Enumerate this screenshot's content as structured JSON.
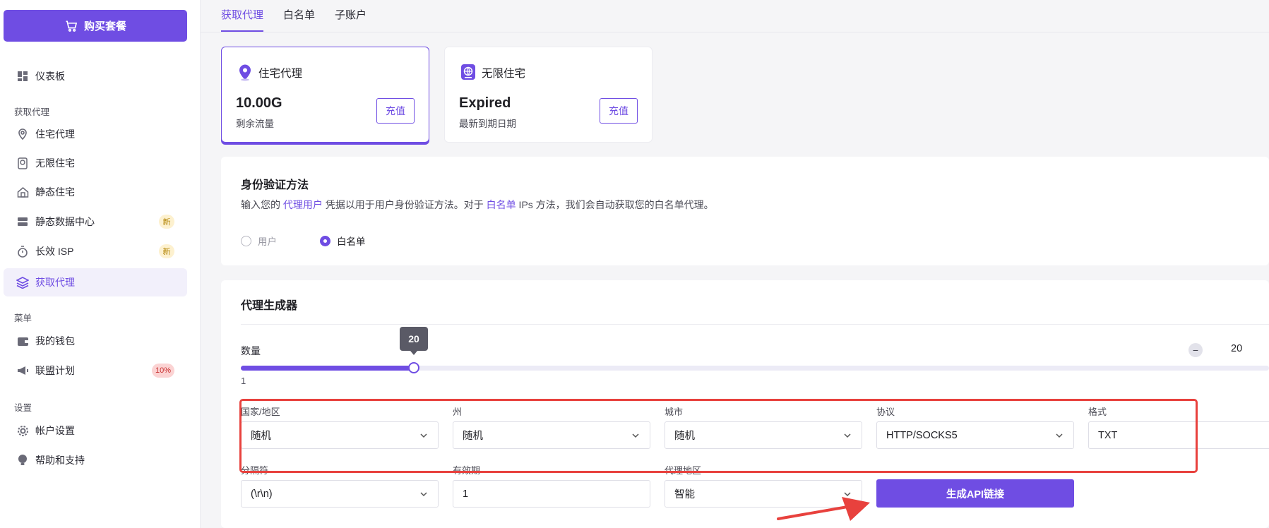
{
  "sidebar": {
    "buy_button": "购买套餐",
    "items": [
      {
        "label": "仪表板"
      },
      {
        "label": "住宅代理"
      },
      {
        "label": "无限住宅"
      },
      {
        "label": "静态住宅"
      },
      {
        "label": "静态数据中心",
        "badge": "新"
      },
      {
        "label": "长效 ISP",
        "badge": "新"
      },
      {
        "label": "获取代理"
      },
      {
        "label": "我的钱包"
      },
      {
        "label": "联盟计划",
        "badge": "10%"
      },
      {
        "label": "帐户设置"
      },
      {
        "label": "帮助和支持"
      }
    ],
    "sections": [
      "获取代理",
      "菜单",
      "设置"
    ]
  },
  "tabs": [
    "获取代理",
    "白名单",
    "子账户"
  ],
  "products": [
    {
      "title": "住宅代理",
      "value": "10.00G",
      "sub": "剩余流量",
      "button": "充值"
    },
    {
      "title": "无限住宅",
      "value": "Expired",
      "sub": "最新到期日期",
      "button": "充值"
    }
  ],
  "auth": {
    "title": "身份验证方法",
    "desc_1": "输入您的 ",
    "desc_link_1": "代理用户",
    "desc_2": " 凭据以用于用户身份验证方法。对于 ",
    "desc_link_2": "白名单",
    "desc_3": " IPs 方法，我们会自动获取您的白名单代理。",
    "options": [
      "用户",
      "白名单"
    ],
    "selected": "白名单"
  },
  "generator": {
    "title": "代理生成器",
    "quantity_label": "数量",
    "quantity_value": "20",
    "slider_min": "1",
    "slider_fraction": 0.168,
    "fields": [
      {
        "label": "国家/地区",
        "value": "随机"
      },
      {
        "label": "州",
        "value": "随机"
      },
      {
        "label": "城市",
        "value": "随机"
      },
      {
        "label": "协议",
        "value": "HTTP/SOCKS5"
      },
      {
        "label": "格式",
        "value": "TXT"
      },
      {
        "label": "分隔符",
        "value": "(\\r\\n)"
      },
      {
        "label": "有效期",
        "value": "1"
      },
      {
        "label": "代理地区",
        "value": "智能"
      }
    ],
    "generate_button": "生成API链接"
  },
  "colors": {
    "accent": "#6f4de3",
    "annotation": "#e8413d"
  }
}
